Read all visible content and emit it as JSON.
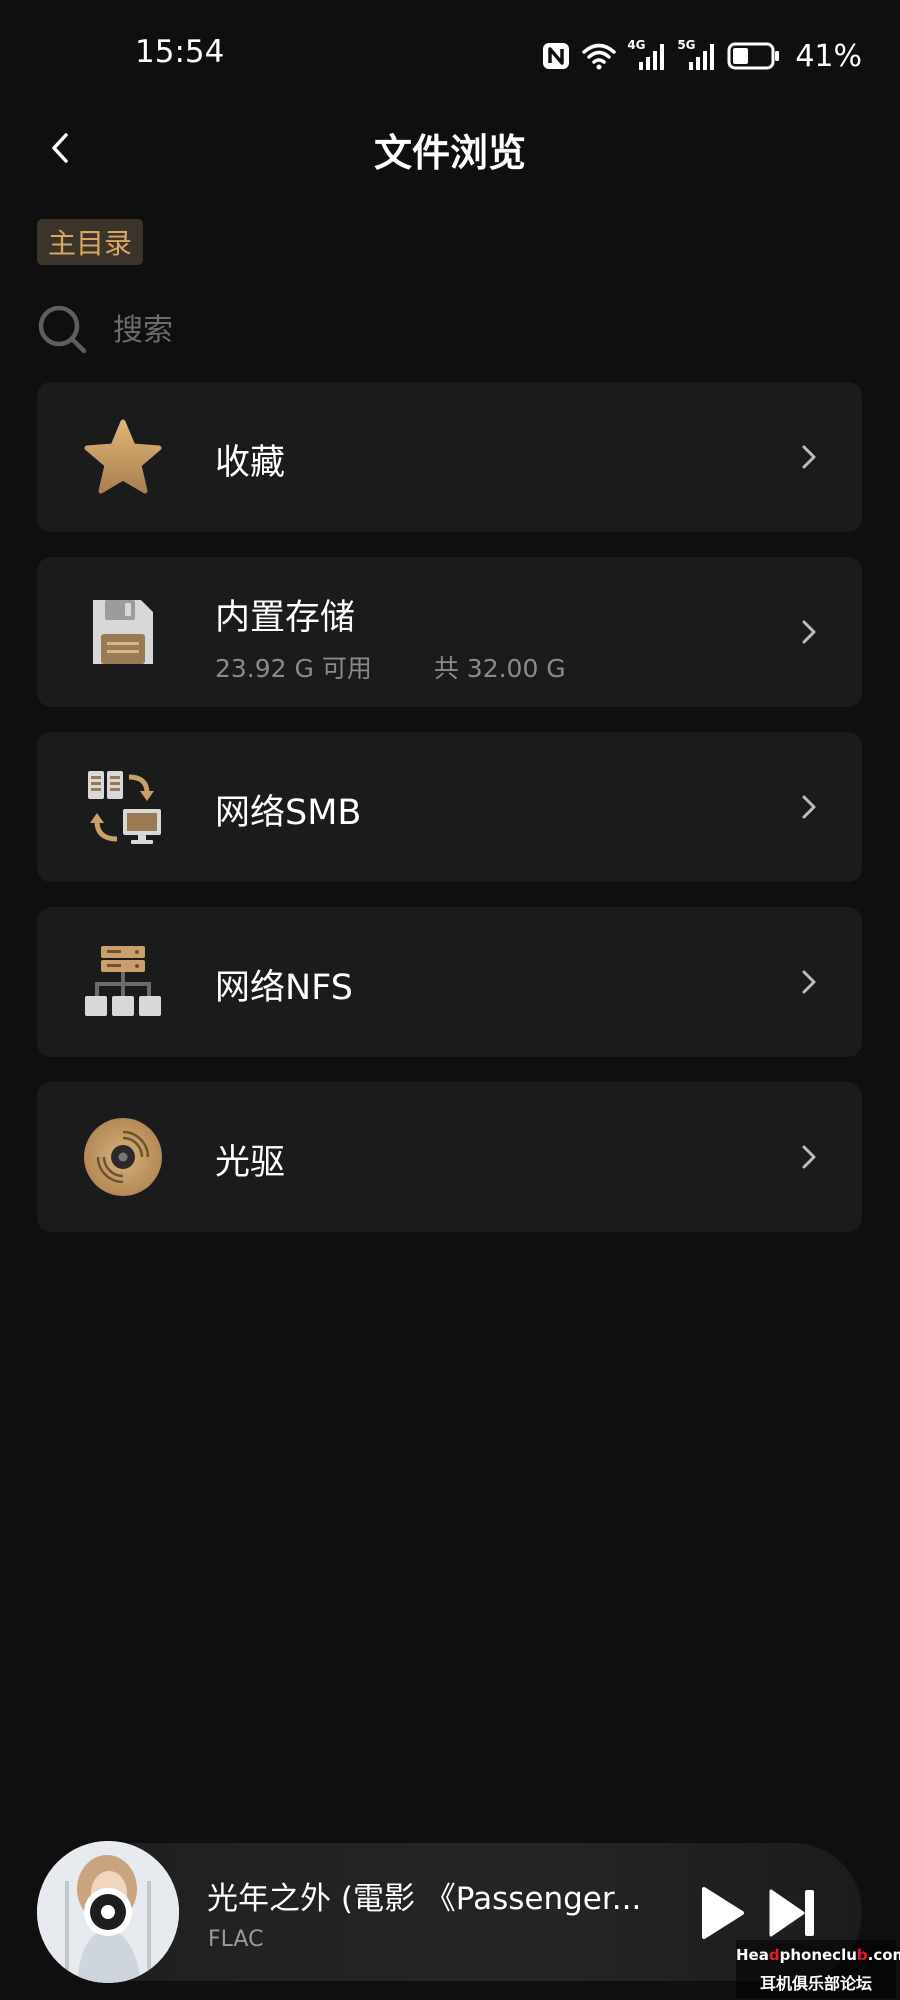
{
  "status_bar": {
    "time": "15:54",
    "network_1": "4G",
    "network_2": "5G",
    "battery_percent": "41%",
    "battery_level": 0.41
  },
  "header": {
    "title": "文件浏览"
  },
  "breadcrumb": {
    "current": "主目录"
  },
  "search": {
    "placeholder": "搜索"
  },
  "items": [
    {
      "label": "收藏",
      "icon": "star-icon"
    },
    {
      "label": "内置存储",
      "icon": "floppy-disk-icon",
      "available": "23.92 G 可用",
      "total": "共 32.00 G"
    },
    {
      "label": "网络SMB",
      "icon": "smb-transfer-icon"
    },
    {
      "label": "网络NFS",
      "icon": "network-tree-icon"
    },
    {
      "label": "光驱",
      "icon": "disc-icon"
    }
  ],
  "player": {
    "title": "光年之外 (電影 《Passenger...",
    "format": "FLAC"
  },
  "watermark": {
    "line1_a": "Hea",
    "line1_b": "d",
    "line1_c": "phoneclu",
    "line1_d": "b",
    "line1_e": ".com",
    "line2": "耳机俱乐部论坛"
  },
  "colors": {
    "accent": "#d9a664",
    "background": "#0f0f0f",
    "card": "#1b1b1b",
    "icon_gold": "#c9a06a"
  }
}
